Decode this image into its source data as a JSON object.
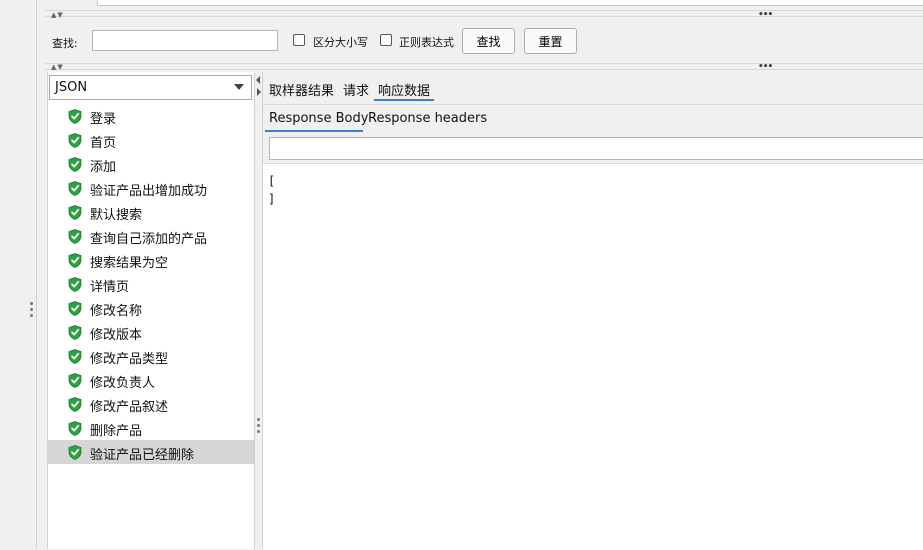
{
  "search_bar": {
    "label": "查找:",
    "input_value": "",
    "case_sensitive_label": "区分大小写",
    "regex_label": "正则表达式",
    "find_button": "查找",
    "reset_button": "重置"
  },
  "renderer": {
    "selected": "JSON"
  },
  "tree": {
    "items": [
      {
        "label": "登录",
        "status": "success"
      },
      {
        "label": "首页",
        "status": "success"
      },
      {
        "label": "添加",
        "status": "success"
      },
      {
        "label": "验证产品出增加成功",
        "status": "success"
      },
      {
        "label": "默认搜索",
        "status": "success"
      },
      {
        "label": "查询自己添加的产品",
        "status": "success"
      },
      {
        "label": "搜索结果为空",
        "status": "success"
      },
      {
        "label": "详情页",
        "status": "success"
      },
      {
        "label": "修改名称",
        "status": "success"
      },
      {
        "label": "修改版本",
        "status": "success"
      },
      {
        "label": "修改产品类型",
        "status": "success"
      },
      {
        "label": "修改负责人",
        "status": "success"
      },
      {
        "label": "修改产品叙述",
        "status": "success"
      },
      {
        "label": "删除产品",
        "status": "success"
      },
      {
        "label": "验证产品已经删除",
        "status": "success",
        "selected": true
      }
    ],
    "icon": "green-shield-check-icon"
  },
  "result_tabs": {
    "tabs": [
      "取样器结果",
      "请求",
      "响应数据"
    ],
    "active": "响应数据"
  },
  "response_tabs": {
    "tabs": [
      "Response Body",
      "Response headers"
    ],
    "active": "Response Body"
  },
  "response": {
    "filter_value": "",
    "body_lines": [
      "[",
      "]"
    ]
  },
  "colors": {
    "accent_underline": "#3c7fc4",
    "success_icon": "#2ea043",
    "selected_row": "#d6d6d6"
  }
}
